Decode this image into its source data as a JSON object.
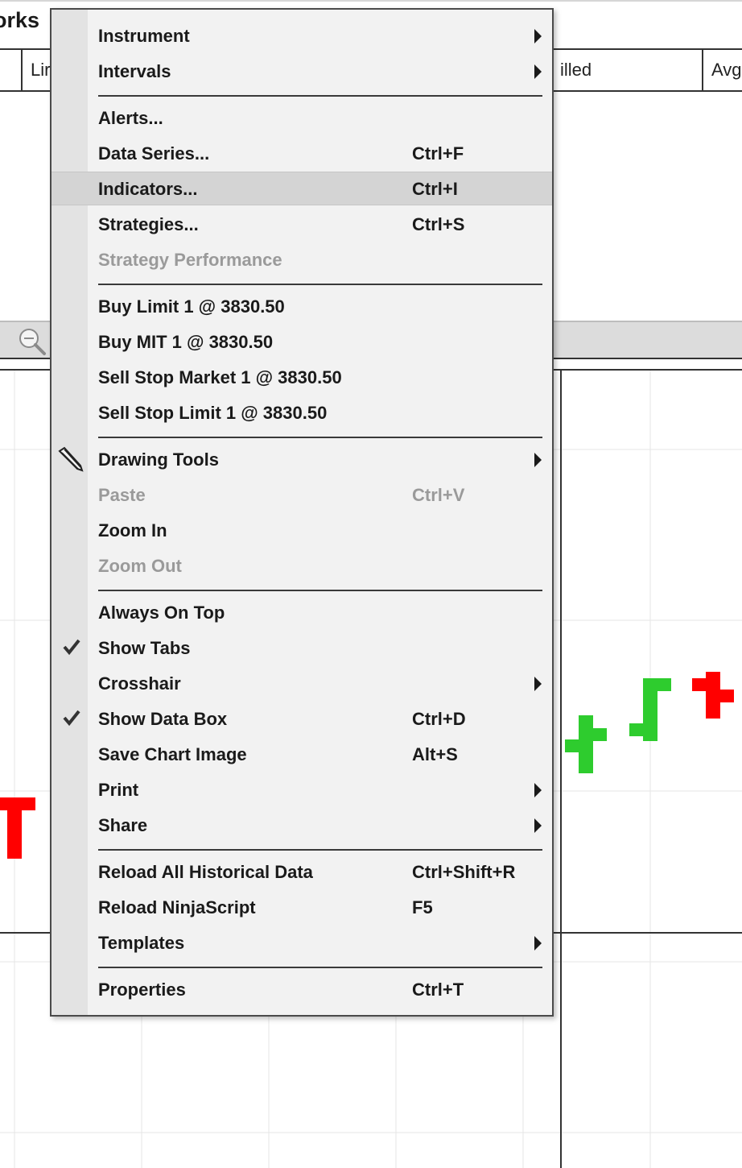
{
  "background": {
    "title": "orks",
    "columns": [
      "Lir",
      "illed",
      "Avg"
    ],
    "colors": {
      "up_bar": "#2ecc2e",
      "down_bar": "#ff0000",
      "grid": "#e6e6e6"
    }
  },
  "menu": {
    "items": [
      {
        "label": "Instrument",
        "shortcut": "",
        "submenu": true,
        "disabled": false
      },
      {
        "label": "Intervals",
        "shortcut": "",
        "submenu": true,
        "disabled": false
      },
      {
        "label": "Alerts...",
        "shortcut": "",
        "submenu": false,
        "disabled": false
      },
      {
        "label": "Data Series...",
        "shortcut": "Ctrl+F",
        "submenu": false,
        "disabled": false
      },
      {
        "label": "Indicators...",
        "shortcut": "Ctrl+I",
        "submenu": false,
        "disabled": false,
        "highlighted": true
      },
      {
        "label": "Strategies...",
        "shortcut": "Ctrl+S",
        "submenu": false,
        "disabled": false
      },
      {
        "label": "Strategy Performance",
        "shortcut": "",
        "submenu": false,
        "disabled": true
      },
      {
        "label": "Buy Limit 1 @ 3830.50",
        "shortcut": "",
        "submenu": false,
        "disabled": false
      },
      {
        "label": "Buy MIT 1 @ 3830.50",
        "shortcut": "",
        "submenu": false,
        "disabled": false
      },
      {
        "label": "Sell Stop Market 1 @ 3830.50",
        "shortcut": "",
        "submenu": false,
        "disabled": false
      },
      {
        "label": "Sell Stop Limit 1 @ 3830.50",
        "shortcut": "",
        "submenu": false,
        "disabled": false
      },
      {
        "label": "Drawing Tools",
        "shortcut": "",
        "submenu": true,
        "disabled": false,
        "icon": "pencil-icon"
      },
      {
        "label": "Paste",
        "shortcut": "Ctrl+V",
        "submenu": false,
        "disabled": true
      },
      {
        "label": "Zoom In",
        "shortcut": "",
        "submenu": false,
        "disabled": false
      },
      {
        "label": "Zoom Out",
        "shortcut": "",
        "submenu": false,
        "disabled": true
      },
      {
        "label": "Always On Top",
        "shortcut": "",
        "submenu": false,
        "disabled": false
      },
      {
        "label": "Show Tabs",
        "shortcut": "",
        "submenu": false,
        "disabled": false,
        "checked": true
      },
      {
        "label": "Crosshair",
        "shortcut": "",
        "submenu": true,
        "disabled": false
      },
      {
        "label": "Show Data Box",
        "shortcut": "Ctrl+D",
        "submenu": false,
        "disabled": false,
        "checked": true
      },
      {
        "label": "Save Chart Image",
        "shortcut": "Alt+S",
        "submenu": false,
        "disabled": false
      },
      {
        "label": "Print",
        "shortcut": "",
        "submenu": true,
        "disabled": false
      },
      {
        "label": "Share",
        "shortcut": "",
        "submenu": true,
        "disabled": false
      },
      {
        "label": "Reload All Historical Data",
        "shortcut": "Ctrl+Shift+R",
        "submenu": false,
        "disabled": false
      },
      {
        "label": "Reload NinjaScript",
        "shortcut": "F5",
        "submenu": false,
        "disabled": false
      },
      {
        "label": "Templates",
        "shortcut": "",
        "submenu": true,
        "disabled": false
      },
      {
        "label": "Properties",
        "shortcut": "Ctrl+T",
        "submenu": false,
        "disabled": false
      }
    ]
  }
}
